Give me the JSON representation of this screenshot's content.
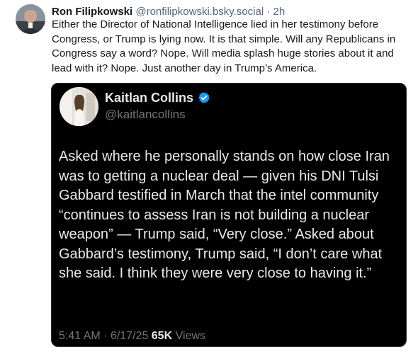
{
  "post": {
    "author_name": "Ron Filipkowski",
    "author_handle": "@ronfilipkowski.bsky.social",
    "separator": " · ",
    "time": "2h",
    "text": "Either the Director of National Intelligence lied in her testimony before Congress, or Trump is lying now. It is that simple. Will any Republicans in Congress say a word? Nope. Will media splash huge stories about it and lead with it? Nope. Just another day in Trump’s America."
  },
  "embed": {
    "author_name": "Kaitlan Collins",
    "author_handle": "@kaitlancollins",
    "verified_icon": "verified-badge-icon",
    "verified_color": "#1d9bf0",
    "text": "Asked where he personally stands on how close Iran was to getting a nuclear deal — given his DNI Tulsi Gabbard testified in March that the intel community “continues to assess Iran is not building a nuclear weapon” — Trump said, “Very close.” Asked about Gabbard’s testimony, Trump said, “I don’t care what she said. I think they were very close to having it.”",
    "time": "5:41 AM",
    "meta_separator": " · ",
    "date": "6/17/25",
    "views_count": "65K",
    "views_label": "Views"
  },
  "colors": {
    "background": "#ffffff",
    "embed_background": "#000000",
    "muted": "#54657a",
    "embed_text": "#e7e9ea",
    "embed_muted": "#71767b"
  }
}
